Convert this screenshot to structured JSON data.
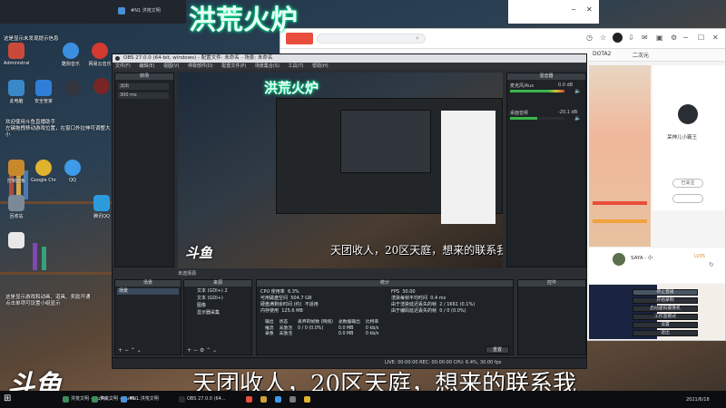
{
  "overlay": {
    "title": "洪荒火炉",
    "caption": "天团收人，20区天庭，想来的联系我",
    "brand": "斗鱼"
  },
  "desktop": {
    "notes": [
      "这是显示未发现提示信息",
      "欢迎使用斗鱼直播助手\n左键拖拽移动游戏位置，在窗口外拉伸可调整大小",
      "这是显示游戏和动画、道具、奖励开通\n点击单项可设置小组显示"
    ],
    "icons": [
      {
        "label": "Administrator",
        "color": "#c94a3a"
      },
      {
        "label": "酷狗音乐",
        "color": "#3b8fe0"
      },
      {
        "label": "网易云音乐",
        "color": "#d33a31"
      },
      {
        "label": "此电脑",
        "color": "#3b88c9"
      },
      {
        "label": "安全管家",
        "color": "#2f7fd8"
      },
      {
        "label": "",
        "color": "#303540"
      },
      {
        "label": "控制面板",
        "color": "#c7892a"
      },
      {
        "label": "Google Chrome",
        "color": "#e0b32e"
      },
      {
        "label": "QQ",
        "color": "#3d9be9"
      },
      {
        "label": "回收站",
        "color": "#7b8a98"
      },
      {
        "label": "腾讯QQ",
        "color": "#2c9bdc"
      },
      {
        "label": "",
        "color": "#e8e8e8"
      }
    ]
  },
  "browser": {
    "address": "",
    "tabs": [
      "DOTA2",
      "二次元"
    ],
    "profile_name": "呆神儿小霸王",
    "follow_label": "已关注",
    "chat_user": "SAYA · 小",
    "chat_level": "LV35"
  },
  "obs": {
    "title": "OBS 27.0.0 (64-bit, windows) - 配置文件: 未命名 - 场景: 未命名",
    "menu": [
      "文件(F)",
      "编辑(E)",
      "视图(V)",
      "停靠部件(D)",
      "配置文件(P)",
      "场景集合(S)",
      "工具(T)",
      "帮助(H)"
    ],
    "panels": {
      "scenes": "场景",
      "sources": "来源",
      "mixer": "混音器",
      "transitions": "转场",
      "controls": "控件",
      "stats": "统计"
    },
    "preview_label": "未选择源",
    "sources": [
      {
        "name": "文本 (GDI+) 2"
      },
      {
        "name": "文本 (GDI+)"
      },
      {
        "name": "图像"
      },
      {
        "name": "显示器采集"
      }
    ],
    "controls": [
      "停止直播",
      "开始录制",
      "启动虚拟摄像机",
      "工作室模式",
      "设置",
      "退出"
    ],
    "stats": {
      "rows_left": [
        [
          "CPU 使用率",
          "6.3%"
        ],
        [
          "可用磁盘空间",
          "504.7 GB"
        ],
        [
          "硬盘满剩余时间 (约)",
          "不适用"
        ],
        [
          "内存使用",
          "125.6 MB"
        ]
      ],
      "rows_right": [
        [
          "FPS",
          "30.00"
        ],
        [
          "渲染每帧平均时间",
          "0.4 ms"
        ],
        [
          "由于渲染延迟丢失的帧",
          "2 / 1661 (0.1%)"
        ],
        [
          "由于编码延迟丢失的帧",
          "0 / 0 (0.0%)"
        ]
      ],
      "table_head": [
        "输出",
        "状态",
        "丢弃的帧数 (网络)",
        "总数据输出",
        "比特率"
      ],
      "table_rows": [
        [
          "推流",
          "未激活",
          "0 / 0 (0.0%)",
          "0.0 MB",
          "0 kb/s"
        ],
        [
          "录像",
          "未激活",
          "",
          "0.0 MB",
          "0 kb/s"
        ]
      ],
      "reset": "重置"
    },
    "mixer_channels": [
      {
        "name": "麦克风/Aux",
        "db": "0.0 dB"
      },
      {
        "name": "桌面音频",
        "db": "-20.1 dB"
      }
    ],
    "status_bar": "LIVE: 00:00:00   REC: 00:00:00   CPU: 6.4%, 30.00 fps",
    "transition": {
      "type": "淡出",
      "duration": "300 ms"
    }
  },
  "taskbar": {
    "items": [
      "洪荒文明 - MuMu...",
      "洪荒文明 - MuMu...",
      "#N1 洪荒文明",
      "OBS 27.0.0 (64...",
      "",
      "",
      "",
      "",
      ""
    ],
    "clock": "2021/6/18"
  },
  "colors": {
    "accent": "#00ffa2",
    "live": "#e8443a"
  }
}
